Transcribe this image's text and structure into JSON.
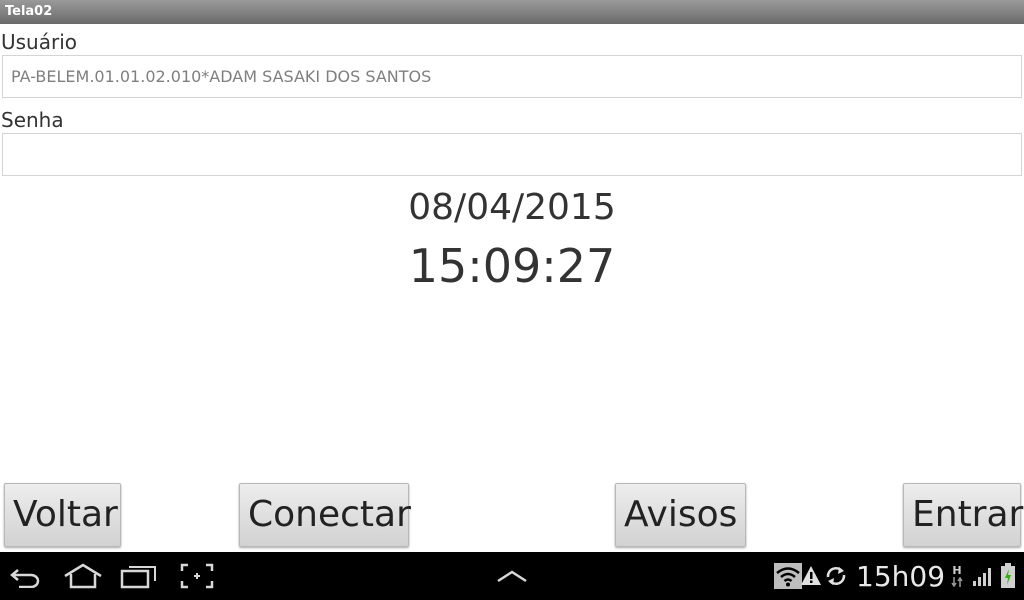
{
  "window": {
    "title": "Tela02"
  },
  "form": {
    "user_label": "Usuário",
    "user_value": "PA-BELEM.01.01.02.010*ADAM SASAKI DOS SANTOS",
    "password_label": "Senha",
    "password_value": ""
  },
  "datetime": {
    "date": "08/04/2015",
    "time": "15:09:27"
  },
  "buttons": {
    "back": "Voltar",
    "connect": "Conectar",
    "notices": "Avisos",
    "enter": "Entrar"
  },
  "system_bar": {
    "clock": "15h09",
    "icons": [
      "back-icon",
      "home-icon",
      "recent-apps-icon",
      "screenshot-icon",
      "chevron-up-icon",
      "wifi-icon",
      "warning-icon",
      "sync-icon",
      "network-type-icon",
      "signal-icon",
      "battery-icon"
    ],
    "network_type": "H"
  },
  "colors": {
    "title_bar": "#808080",
    "nav_bar": "#000000",
    "text": "#333333",
    "button_face": "#e0e0e0"
  }
}
